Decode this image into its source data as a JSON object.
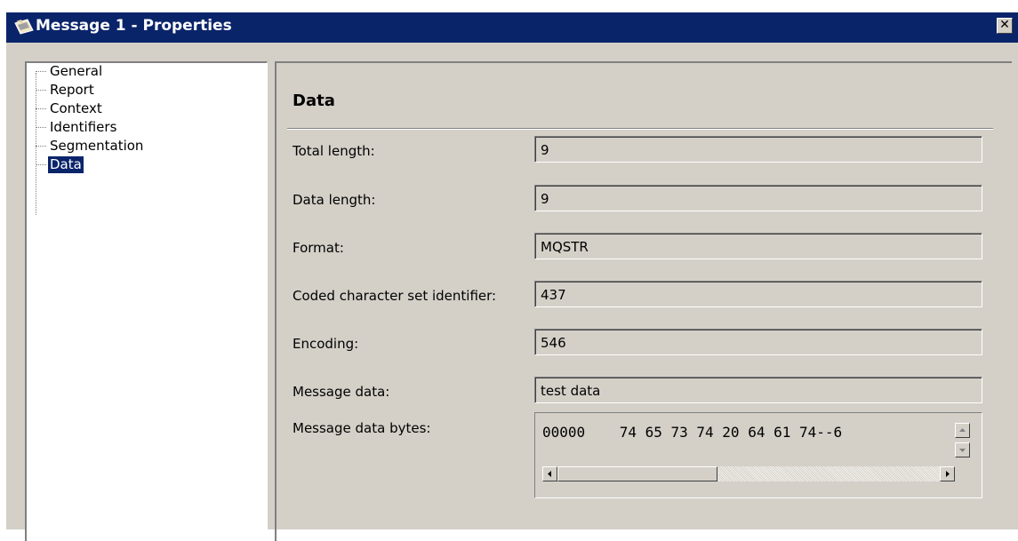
{
  "window": {
    "title": "Message 1 - Properties",
    "close_label": "✕"
  },
  "tree": {
    "items": [
      {
        "label": "General",
        "selected": false
      },
      {
        "label": "Report",
        "selected": false
      },
      {
        "label": "Context",
        "selected": false
      },
      {
        "label": "Identifiers",
        "selected": false
      },
      {
        "label": "Segmentation",
        "selected": false
      },
      {
        "label": "Data",
        "selected": true
      }
    ]
  },
  "panel": {
    "heading": "Data",
    "fields": [
      {
        "label": "Total length:",
        "value": "9"
      },
      {
        "label": "Data length:",
        "value": "9"
      },
      {
        "label": "Format:",
        "value": "MQSTR"
      },
      {
        "label": "Coded character set identifier:",
        "value": "437"
      },
      {
        "label": "Encoding:",
        "value": "546"
      },
      {
        "label": "Message data:",
        "value": "test data"
      }
    ],
    "bytes": {
      "label": "Message data bytes:",
      "value": "00000    74 65 73 74 20 64 61 74--6"
    }
  },
  "colors": {
    "titlebar": "#0a246a",
    "selection": "#0a246a",
    "face": "#d4d0c8"
  },
  "icons": {
    "window": "pencil-envelope-icon",
    "close": "close-icon",
    "scroll_up": "arrow-up-icon",
    "scroll_down": "arrow-down-icon",
    "scroll_left": "arrow-left-icon",
    "scroll_right": "arrow-right-icon"
  }
}
